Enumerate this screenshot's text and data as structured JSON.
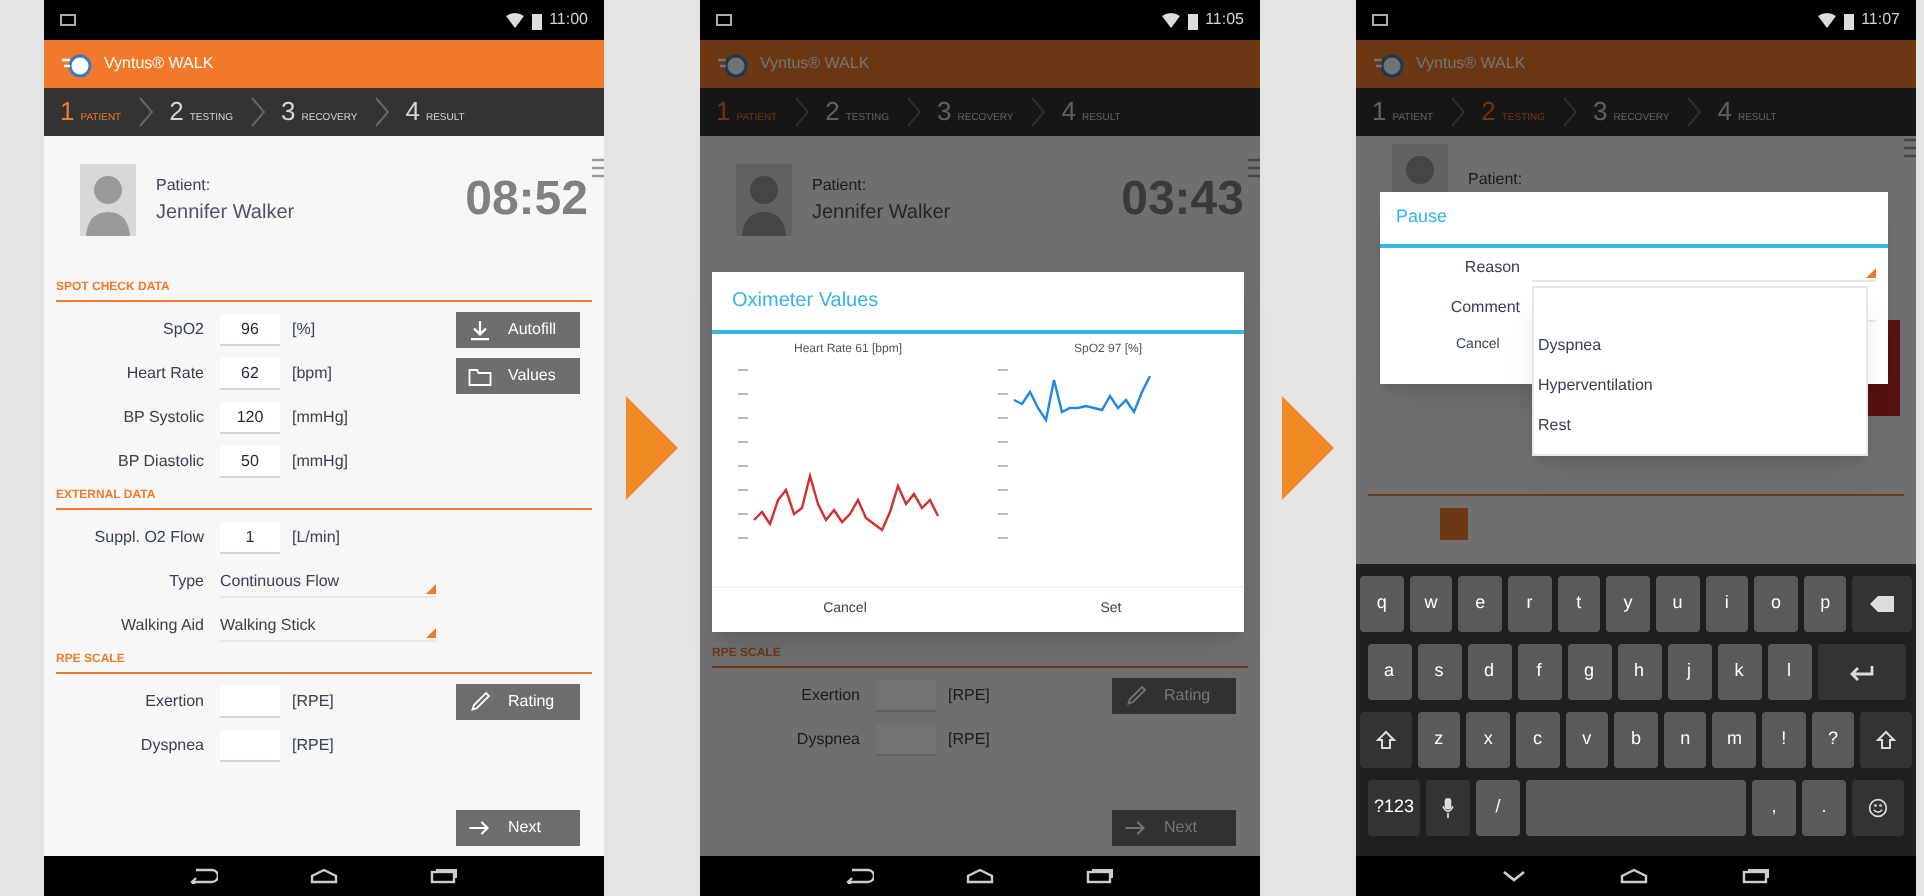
{
  "screens": [
    {
      "kind": "form",
      "status_time": "11:00",
      "app_title": "Vyntus® WALK",
      "steps": [
        {
          "number": "1",
          "label": "PATIENT",
          "selected": true
        },
        {
          "number": "2",
          "label": "TESTING",
          "selected": false
        },
        {
          "number": "3",
          "label": "RECOVERY",
          "selected": false
        },
        {
          "number": "4",
          "label": "RESULT",
          "selected": false
        }
      ],
      "patient": {
        "label": "Patient:",
        "name": "Jennifer Walker"
      },
      "timer": "08:52",
      "sections": [
        {
          "title": "SPOT CHECK DATA",
          "rows": [
            {
              "kind": "input",
              "label": "SpO2",
              "value": "96",
              "unit": "[%]"
            },
            {
              "kind": "input",
              "label": "Heart Rate",
              "value": "62",
              "unit": "[bpm]"
            },
            {
              "kind": "input",
              "label": "BP Systolic",
              "value": "120",
              "unit": "[mmHg]"
            },
            {
              "kind": "input",
              "label": "BP Diastolic",
              "value": "50",
              "unit": "[mmHg]"
            }
          ],
          "buttons": [
            {
              "kind": "download",
              "label": "Autofill"
            },
            {
              "kind": "folder",
              "label": "Values"
            }
          ]
        },
        {
          "title": "EXTERNAL DATA",
          "rows": [
            {
              "kind": "input",
              "label": "Suppl. O2 Flow",
              "value": "1",
              "unit": "[L/min]"
            },
            {
              "kind": "select",
              "label": "Type",
              "value": "Continuous Flow"
            },
            {
              "kind": "select",
              "label": "Walking Aid",
              "value": "Walking Stick"
            }
          ]
        },
        {
          "title": "RPE SCALE",
          "rows": [
            {
              "kind": "input",
              "label": "Exertion",
              "unit": "[RPE]"
            },
            {
              "kind": "input",
              "label": "Dyspnea",
              "unit": "[RPE]"
            }
          ],
          "buttons": [
            {
              "kind": "pencil",
              "label": "Rating"
            }
          ]
        }
      ],
      "next_button": {
        "kind": "arrow",
        "label": "Next"
      }
    },
    {
      "kind": "dialog",
      "status_time": "11:05",
      "app_title": "Vyntus® WALK",
      "steps": [
        {
          "number": "1",
          "label": "PATIENT",
          "selected": true
        },
        {
          "number": "2",
          "label": "TESTING",
          "selected": false
        },
        {
          "number": "3",
          "label": "RECOVERY",
          "selected": false
        },
        {
          "number": "4",
          "label": "RESULT",
          "selected": false
        }
      ],
      "patient": {
        "label": "Patient:",
        "name": "Jennifer Walker"
      },
      "timer": "03:43",
      "sections": [
        {
          "title": "RPE SCALE",
          "rows": [
            {
              "kind": "input",
              "label": "Exertion",
              "unit": "[RPE]"
            },
            {
              "kind": "input",
              "label": "Dyspnea",
              "unit": "[RPE]"
            }
          ],
          "buttons": [
            {
              "kind": "pencil",
              "label": "Rating"
            }
          ]
        }
      ],
      "next_button": {
        "kind": "arrow",
        "label": "Next"
      },
      "dialog": {
        "title": "Oximeter Values",
        "charts": [
          {
            "title": "Heart Rate 61 [bpm]",
            "color": "#d32f2f"
          },
          {
            "title": "SpO2 97 [%]",
            "color": "#1e88e5"
          }
        ],
        "buttons": [
          "Cancel",
          "Set"
        ]
      }
    },
    {
      "kind": "keyboard",
      "status_time": "11:07",
      "app_title": "Vyntus® WALK",
      "steps": [
        {
          "number": "1",
          "label": "PATIENT",
          "selected": false
        },
        {
          "number": "2",
          "label": "TESTING",
          "selected": true
        },
        {
          "number": "3",
          "label": "RECOVERY",
          "selected": false
        },
        {
          "number": "4",
          "label": "RESULT",
          "selected": false
        }
      ],
      "patient": {
        "label": "Patient:"
      },
      "dialog": {
        "title": "Pause",
        "fields": [
          {
            "kind": "select",
            "label": "Reason"
          },
          {
            "kind": "input",
            "label": "Comment"
          }
        ],
        "buttons": [
          "Cancel"
        ]
      },
      "dropdown": [
        "Dyspnea",
        "Hyperventilation",
        "Rest"
      ],
      "keyboard": [
        [
          {
            "kind": "letter",
            "label": "q"
          },
          {
            "kind": "letter",
            "label": "w"
          },
          {
            "kind": "letter",
            "label": "e"
          },
          {
            "kind": "letter",
            "label": "r"
          },
          {
            "kind": "letter",
            "label": "t"
          },
          {
            "kind": "letter",
            "label": "y"
          },
          {
            "kind": "letter",
            "label": "u"
          },
          {
            "kind": "letter",
            "label": "i"
          },
          {
            "kind": "letter",
            "label": "o"
          },
          {
            "kind": "letter",
            "label": "p"
          },
          {
            "kind": "backspace"
          }
        ],
        [
          {
            "kind": "letter",
            "label": "a"
          },
          {
            "kind": "letter",
            "label": "s"
          },
          {
            "kind": "letter",
            "label": "d"
          },
          {
            "kind": "letter",
            "label": "f"
          },
          {
            "kind": "letter",
            "label": "g"
          },
          {
            "kind": "letter",
            "label": "h"
          },
          {
            "kind": "letter",
            "label": "j"
          },
          {
            "kind": "letter",
            "label": "k"
          },
          {
            "kind": "letter",
            "label": "l"
          },
          {
            "kind": "enter"
          }
        ],
        [
          {
            "kind": "shift"
          },
          {
            "kind": "letter",
            "label": "z"
          },
          {
            "kind": "letter",
            "label": "x"
          },
          {
            "kind": "letter",
            "label": "c"
          },
          {
            "kind": "letter",
            "label": "v"
          },
          {
            "kind": "letter",
            "label": "b"
          },
          {
            "kind": "letter",
            "label": "n"
          },
          {
            "kind": "letter",
            "label": "m"
          },
          {
            "kind": "letter",
            "label": "!"
          },
          {
            "kind": "letter",
            "label": "?"
          },
          {
            "kind": "shift"
          }
        ],
        [
          {
            "kind": "mode",
            "label": "?123"
          },
          {
            "kind": "mic"
          },
          {
            "kind": "letter",
            "label": "/"
          },
          {
            "kind": "space"
          },
          {
            "kind": "letter",
            "label": ","
          },
          {
            "kind": "letter",
            "label": "."
          },
          {
            "kind": "emoji"
          }
        ]
      ]
    }
  ]
}
